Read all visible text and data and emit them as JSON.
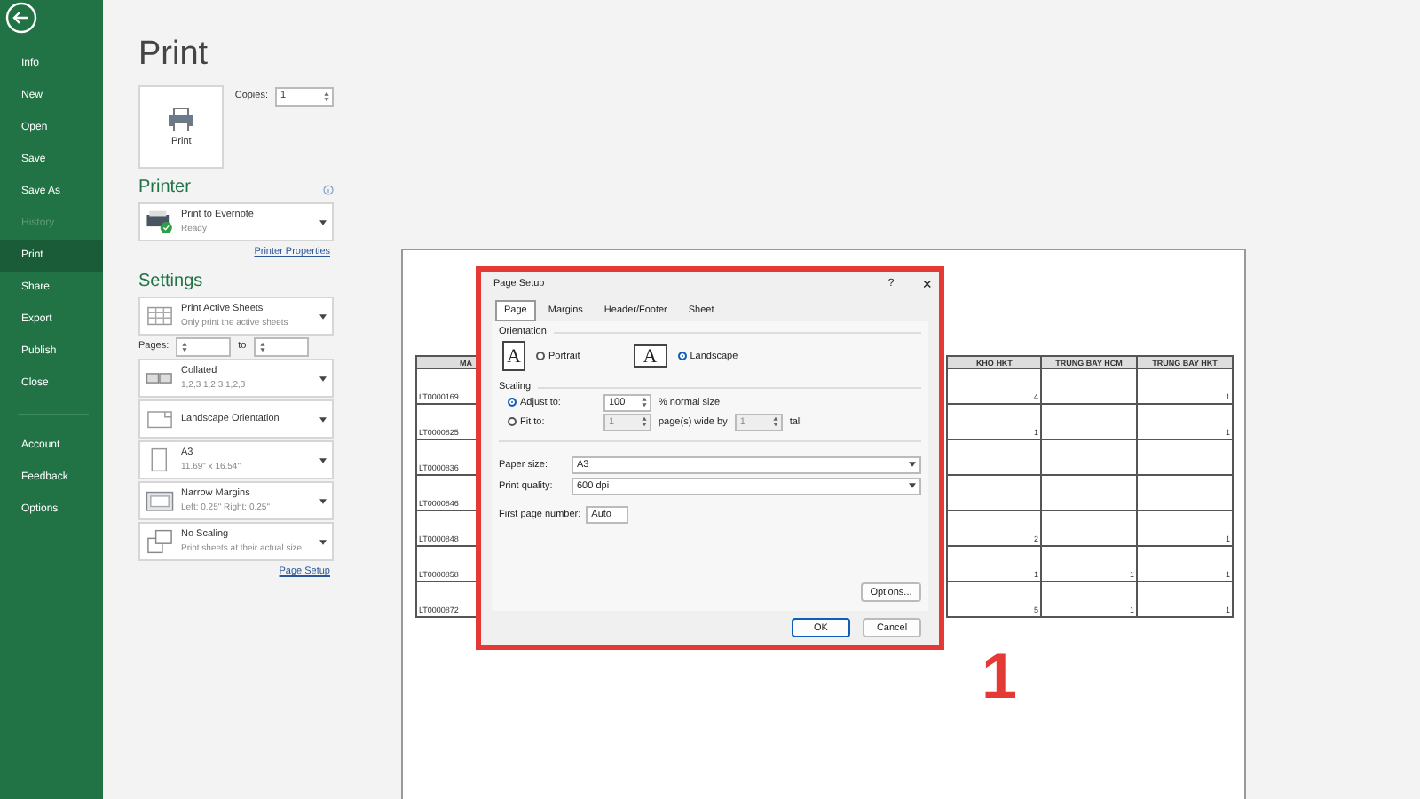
{
  "sidebar": {
    "items": [
      {
        "label": "Info",
        "selected": false,
        "disabled": false
      },
      {
        "label": "New",
        "selected": false,
        "disabled": false
      },
      {
        "label": "Open",
        "selected": false,
        "disabled": false
      },
      {
        "label": "Save",
        "selected": false,
        "disabled": false
      },
      {
        "label": "Save As",
        "selected": false,
        "disabled": false
      },
      {
        "label": "History",
        "selected": false,
        "disabled": true
      },
      {
        "label": "Print",
        "selected": true,
        "disabled": false
      },
      {
        "label": "Share",
        "selected": false,
        "disabled": false
      },
      {
        "label": "Export",
        "selected": false,
        "disabled": false
      },
      {
        "label": "Publish",
        "selected": false,
        "disabled": false
      },
      {
        "label": "Close",
        "selected": false,
        "disabled": false
      }
    ],
    "bottom_items": [
      {
        "label": "Account",
        "selected": false,
        "disabled": false
      },
      {
        "label": "Feedback",
        "selected": false,
        "disabled": false
      },
      {
        "label": "Options",
        "selected": false,
        "disabled": false
      }
    ]
  },
  "print": {
    "title": "Print",
    "button": "Print",
    "copies_label": "Copies:",
    "copies": "1"
  },
  "printer": {
    "heading": "Printer",
    "name": "Print to Evernote",
    "status": "Ready",
    "properties_link": "Printer Properties"
  },
  "settings": {
    "heading": "Settings",
    "options": [
      {
        "kind": "sheets",
        "title": "Print Active Sheets",
        "subtitle": "Only print the active sheets"
      },
      {
        "kind": "pages",
        "label": "Pages:",
        "to_label": "to"
      },
      {
        "kind": "collated",
        "title": "Collated",
        "subtitle": "1,2,3   1,2,3   1,2,3"
      },
      {
        "kind": "orientation",
        "title": "Landscape Orientation"
      },
      {
        "kind": "paper",
        "title": "A3",
        "subtitle": "11.69\" x 16.54\""
      },
      {
        "kind": "margins",
        "title": "Narrow Margins",
        "subtitle": "Left: 0.25\"   Right: 0.25\""
      },
      {
        "kind": "scaling",
        "title": "No Scaling",
        "subtitle": "Print sheets at their actual size"
      }
    ],
    "page_setup_link": "Page Setup"
  },
  "preview": {
    "columns": [
      "MA",
      "KHO HKT",
      "TRUNG BAY HCM",
      "TRUNG BAY HKT"
    ],
    "rows": [
      {
        "cells": [
          "LT0000169",
          "4",
          "",
          "1"
        ]
      },
      {
        "cells": [
          "LT0000825",
          "1",
          "",
          "1"
        ]
      },
      {
        "cells": [
          "LT0000836",
          "",
          "",
          ""
        ]
      },
      {
        "cells": [
          "LT0000846",
          "",
          "",
          ""
        ]
      },
      {
        "cells": [
          "LT0000848",
          "2",
          "",
          "1"
        ]
      },
      {
        "cells": [
          "LT0000858",
          "1",
          "1",
          "1"
        ]
      },
      {
        "cells": [
          "LT0000872",
          "5",
          "1",
          "1"
        ]
      }
    ]
  },
  "dialog": {
    "title": "Page Setup",
    "help": "?",
    "close": "×",
    "tabs": [
      {
        "label": "Page",
        "selected": true
      },
      {
        "label": "Margins",
        "selected": false
      },
      {
        "label": "Header/Footer",
        "selected": false
      },
      {
        "label": "Sheet",
        "selected": false
      }
    ],
    "orientation": {
      "label": "Orientation",
      "options": [
        {
          "icon_letter": "A",
          "label": "Portrait",
          "selected": false,
          "kind": "portrait"
        },
        {
          "icon_letter": "A",
          "label": "Landscape",
          "selected": true,
          "kind": "landscape"
        }
      ]
    },
    "scaling": {
      "label": "Scaling",
      "adjust": {
        "label": "Adjust to:",
        "selected": true,
        "value": "100",
        "suffix": "% normal size"
      },
      "fit": {
        "label": "Fit to:",
        "selected": false,
        "wide": "1",
        "wide_suffix": "page(s) wide by",
        "tall": "1",
        "tall_suffix": "tall"
      }
    },
    "paper_size": {
      "label": "Paper size:",
      "value": "A3"
    },
    "print_quality": {
      "label": "Print quality:",
      "value": "600 dpi"
    },
    "first_page": {
      "label": "First page number:",
      "value": "Auto"
    },
    "options_button": "Options...",
    "ok_button": "OK",
    "cancel_button": "Cancel"
  },
  "annotation": {
    "text": "1"
  }
}
